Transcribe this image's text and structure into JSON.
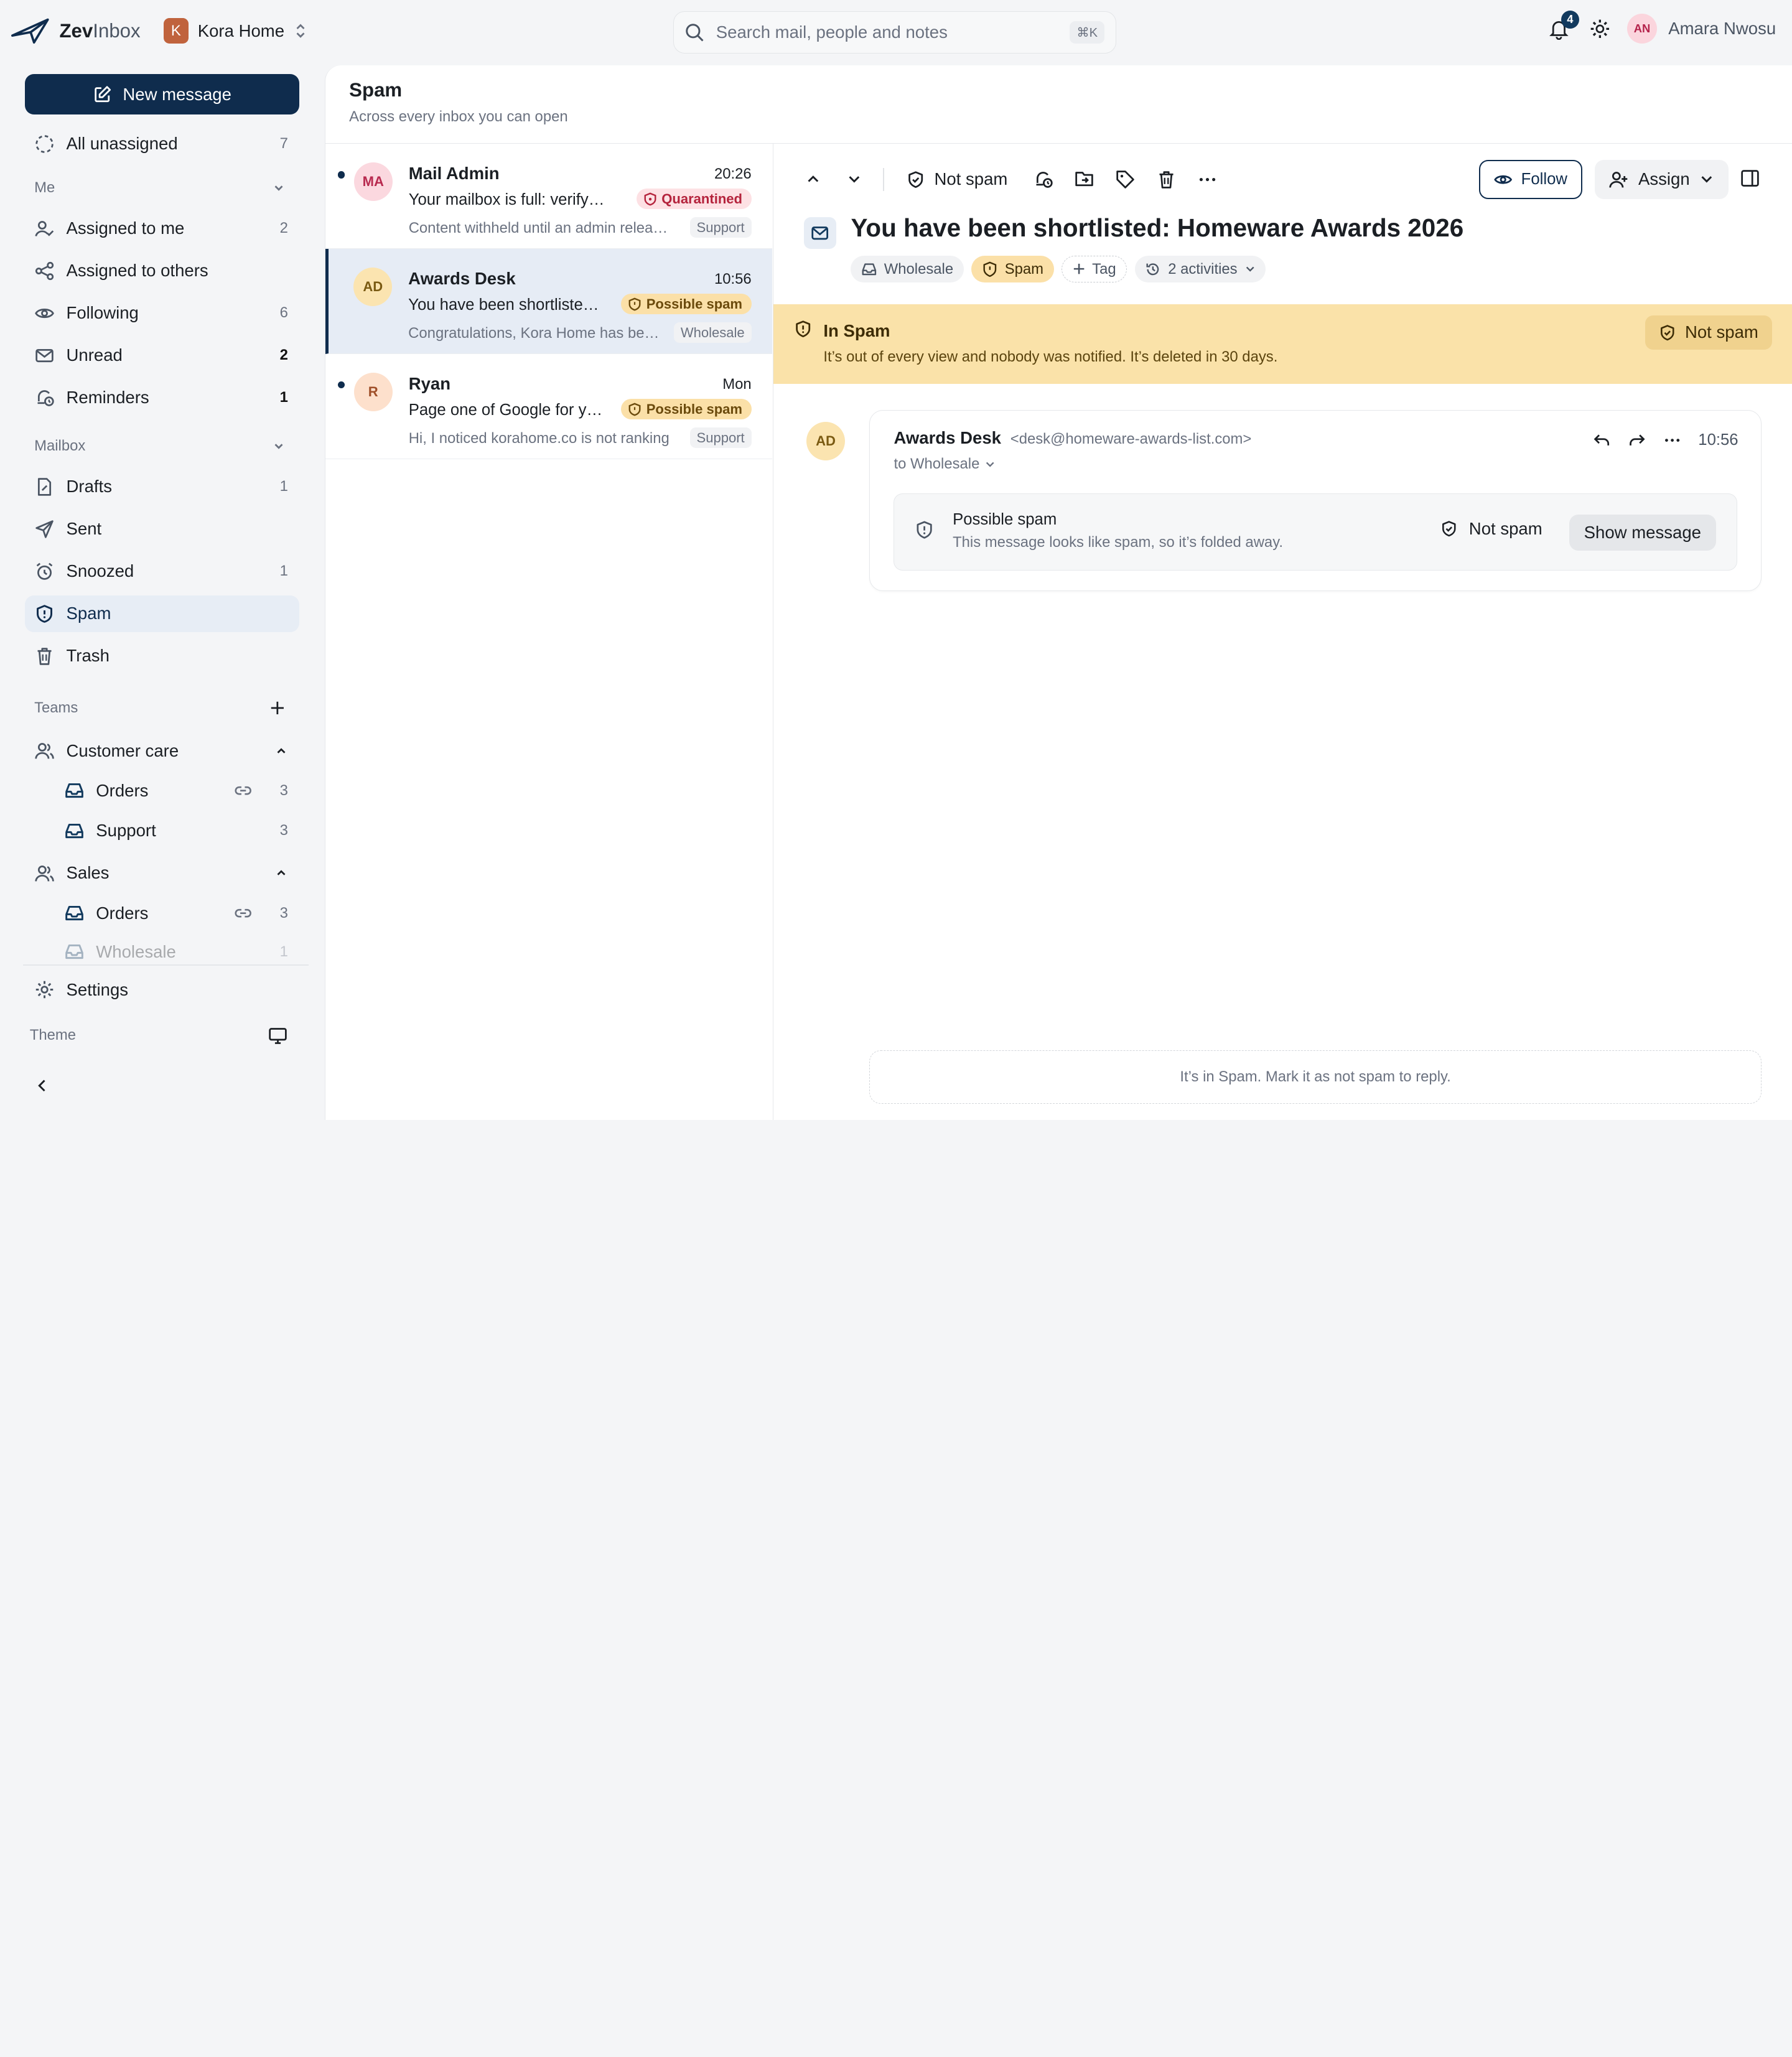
{
  "app": {
    "name_bold": "Zev",
    "name_light": "Inbox",
    "workspace": {
      "initial": "K",
      "name": "Kora Home"
    }
  },
  "search": {
    "placeholder": "Search mail, people and notes",
    "shortcut": "⌘K"
  },
  "topbar": {
    "notification_count": "4",
    "user": {
      "initials": "AN",
      "name": "Amara Nwosu"
    }
  },
  "sidebar": {
    "new_message": "New message",
    "all_unassigned": {
      "label": "All unassigned",
      "count": "7"
    },
    "me_section": "Me",
    "me_items": [
      {
        "label": "Assigned to me",
        "count": "2"
      },
      {
        "label": "Assigned to others",
        "count": ""
      },
      {
        "label": "Following",
        "count": "6"
      },
      {
        "label": "Unread",
        "count": "2"
      },
      {
        "label": "Reminders",
        "count": "1"
      }
    ],
    "mailbox_section": "Mailbox",
    "mailbox_items": [
      {
        "label": "Drafts",
        "count": "1"
      },
      {
        "label": "Sent",
        "count": ""
      },
      {
        "label": "Snoozed",
        "count": "1"
      },
      {
        "label": "Spam",
        "count": ""
      },
      {
        "label": "Trash",
        "count": ""
      }
    ],
    "teams_section": "Teams",
    "teams": [
      {
        "label": "Customer care",
        "inboxes": [
          {
            "label": "Orders",
            "count": "3"
          },
          {
            "label": "Support",
            "count": "3"
          }
        ]
      },
      {
        "label": "Sales",
        "inboxes": [
          {
            "label": "Orders",
            "count": "3"
          },
          {
            "label": "Wholesale",
            "count": "1"
          }
        ]
      }
    ],
    "settings": "Settings",
    "theme": "Theme"
  },
  "main": {
    "title": "Spam",
    "subtitle": "Across every inbox you can open"
  },
  "list": [
    {
      "initials": "MA",
      "sender": "Mail Admin",
      "time": "20:26",
      "subject": "Your mailbox is full: verify your account",
      "badge": "Quarantined",
      "preview": "Content withheld until an admin releases it",
      "inbox": "Support"
    },
    {
      "initials": "AD",
      "sender": "Awards Desk",
      "time": "10:56",
      "subject": "You have been shortlisted: Homeware Awards 2026",
      "badge": "Possible spam",
      "preview": "Congratulations, Kora Home has been shortlisted",
      "inbox": "Wholesale"
    },
    {
      "initials": "R",
      "sender": "Ryan",
      "time": "Mon",
      "subject": "Page one of Google for your store",
      "badge": "Possible spam",
      "preview": "Hi, I noticed korahome.co is not ranking",
      "inbox": "Support"
    }
  ],
  "detail": {
    "toolbar": {
      "not_spam": "Not spam",
      "follow": "Follow",
      "assign": "Assign"
    },
    "subject": "You have been shortlisted: Homeware Awards 2026",
    "chips": {
      "inbox": "Wholesale",
      "status": "Spam",
      "tag": "Tag",
      "activities": "2 activities"
    },
    "banner": {
      "title": "In Spam",
      "text": "It’s out of every view and nobody was notified. It’s deleted in 30 days.",
      "button": "Not spam"
    },
    "message": {
      "initials": "AD",
      "from": "Awards Desk",
      "email": "<desk@homeware-awards-list.com>",
      "to": "to Wholesale",
      "time": "10:56",
      "fold_title": "Possible spam",
      "fold_text": "This message looks like spam, so it’s folded away.",
      "fold_not_spam": "Not spam",
      "fold_show": "Show message"
    },
    "reply_notice": "It’s in Spam. Mark it as not spam to reply."
  },
  "colors": {
    "brand_navy": "#0f2c4d",
    "spam_banner": "#fae2a9",
    "quarantined_red": "#b4233c",
    "selected_row": "#e6ecf5"
  }
}
